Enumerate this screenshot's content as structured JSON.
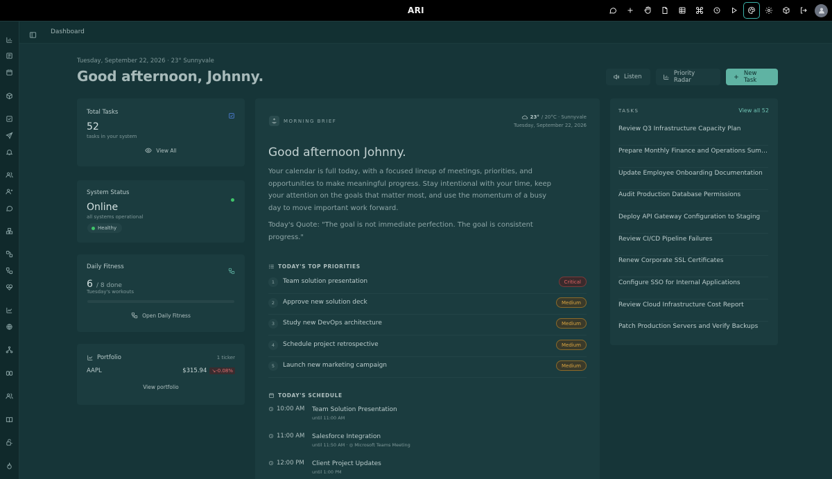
{
  "app": {
    "title": "ARI"
  },
  "breadcrumb": {
    "current": "Dashboard"
  },
  "header": {
    "date_line": "Tuesday, September 22, 2026 · 23° Sunnyvale",
    "greeting": "Good afternoon, Johnny.",
    "listen_label": "Listen",
    "radar_label": "Priority Radar",
    "new_task_label": "New Task"
  },
  "cards": {
    "total_tasks": {
      "title": "Total Tasks",
      "value": "52",
      "sub": "tasks in your system",
      "link": "View All"
    },
    "system_status": {
      "title": "System Status",
      "value": "Online",
      "sub": "all systems operational",
      "badge": "Healthy"
    },
    "fitness": {
      "title": "Daily Fitness",
      "value": "6",
      "of": "/ 8 done",
      "sub": "Tuesday's workouts",
      "link": "Open Daily Fitness",
      "progress": 0.0
    },
    "portfolio": {
      "title": "Portfolio",
      "count": "1 ticker",
      "symbol": "AAPL",
      "price": "$315.94",
      "change": "-0.08%",
      "link": "View portfolio"
    }
  },
  "brief": {
    "label": "MORNING BRIEF",
    "weather_temp": "23°",
    "weather_rest": "/ 20°C · Sunnyvale",
    "weather_date": "Tuesday, September 22, 2026",
    "title": "Good afternoon Johnny.",
    "body": "Your calendar is full today, with a focused lineup of meetings, priorities, and opportunities to make meaningful progress. Stay intentional with your time, keep your attention on the goals that matter most, and use the momentum of a busy day to move important work forward.",
    "quote": "Today's Quote: \"The goal is not immediate perfection. The goal is consistent progress.\"",
    "priorities_heading": "TODAY'S TOP PRIORITIES",
    "priorities": [
      {
        "num": "1",
        "text": "Team solution presentation",
        "badge": "Critical"
      },
      {
        "num": "2",
        "text": "Approve new solution deck",
        "badge": "Medium"
      },
      {
        "num": "3",
        "text": "Study new DevOps architecture",
        "badge": "Medium"
      },
      {
        "num": "4",
        "text": "Schedule project retrospective",
        "badge": "Medium"
      },
      {
        "num": "5",
        "text": "Launch new marketing campaign",
        "badge": "Medium"
      }
    ],
    "schedule_heading": "TODAY'S SCHEDULE",
    "schedule": [
      {
        "time": "10:00 AM",
        "title": "Team Solution Presentation",
        "sub": "until 11:00 AM"
      },
      {
        "time": "11:00 AM",
        "title": "Salesforce Integration",
        "sub": "until 11:50 AM · ◎ Microsoft Teams Meeting"
      },
      {
        "time": "12:00 PM",
        "title": "Client Project Updates",
        "sub": "until 1:00 PM"
      }
    ]
  },
  "tasks": {
    "heading": "TASKS",
    "view_all": "View all 52",
    "items": [
      "Review Q3 Infrastructure Capacity Plan",
      "Prepare Monthly Finance and Operations Summary",
      "Update Employee Onboarding Documentation",
      "Audit Production Database Permissions",
      "Deploy API Gateway Configuration to Staging",
      "Review CI/CD Pipeline Failures",
      "Renew Corporate SSL Certificates",
      "Configure SSO for Internal Applications",
      "Review Cloud Infrastructure Cost Report",
      "Patch Production Servers and Verify Backups"
    ]
  },
  "colors": {
    "accent": "#5fb3a3",
    "critical": "#e06363",
    "medium": "#d9a441",
    "online": "#3fc46a"
  }
}
